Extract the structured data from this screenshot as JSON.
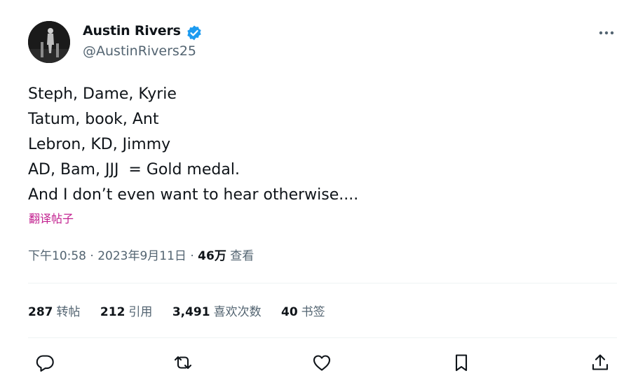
{
  "author": {
    "name": "Austin Rivers",
    "handle": "@AustinRivers25",
    "verified_color": "#1d9bf0"
  },
  "tweet": {
    "lines": [
      "Steph, Dame, Kyrie",
      "Tatum, book, Ant",
      "Lebron, KD, Jimmy",
      "AD, Bam, JJJ  = Gold medal.",
      "And I don’t even want to hear otherwise...."
    ],
    "translate_label": "翻译帖子"
  },
  "meta": {
    "time": "下午10:58",
    "separator": "·",
    "date": "2023年9月11日",
    "views_count": "46万",
    "views_label": "查看"
  },
  "stats": [
    {
      "count": "287",
      "label": "转帖"
    },
    {
      "count": "212",
      "label": "引用"
    },
    {
      "count": "3,491",
      "label": "喜欢次数"
    },
    {
      "count": "40",
      "label": "书签"
    }
  ],
  "actions": [
    "reply-icon",
    "retweet-icon",
    "like-icon",
    "bookmark-icon",
    "share-icon"
  ],
  "colors": {
    "text": "#0f1419",
    "secondary": "#536471",
    "translate_link": "#c2208f",
    "divider": "#eff3f4"
  }
}
